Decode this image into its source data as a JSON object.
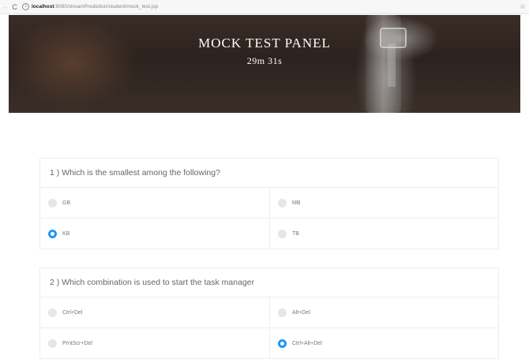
{
  "browser": {
    "back_icon": "back-arrow-icon",
    "reload_icon": "reload-icon",
    "url_host": "localhost",
    "url_rest": ":8080/streamPrediction/student/mock_test.jsp",
    "bookmark_icon": "star-icon"
  },
  "hero": {
    "title": "MOCK TEST PANEL",
    "timer": "29m 31s"
  },
  "questions": [
    {
      "text": "1 ) Which is the smallest among the following?",
      "options": [
        "GB",
        "MB",
        "KB",
        "TB"
      ],
      "selected": "KB"
    },
    {
      "text": "2 ) Which combination is used to start the task manager",
      "options": [
        "Ctrl+Del",
        "Alt+Del",
        "PrntScr+Del",
        "Ctrl+Alt+Del"
      ],
      "selected": "Ctrl+Alt+Del"
    }
  ],
  "colors": {
    "selected_radio": "#2196f3",
    "unselected_radio": "#e6e6e6",
    "hero_text": "#ffffff"
  }
}
